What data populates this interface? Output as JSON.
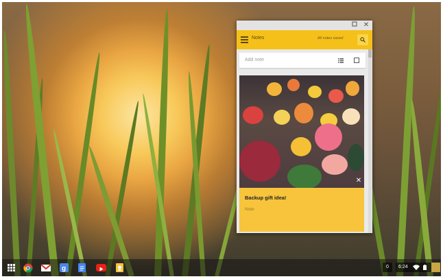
{
  "notes_window": {
    "app_title": "Notes",
    "save_status": "All notes saved",
    "add_note_placeholder": "Add note",
    "note": {
      "title": "Backup gift idea!",
      "placeholder": "Note"
    }
  },
  "shelf": {
    "apps": [
      "apps-launcher",
      "chrome",
      "gmail",
      "google-search",
      "docs",
      "youtube",
      "keep"
    ],
    "notification_count": "0",
    "clock": "6:24"
  },
  "colors": {
    "header": "#f6c01a",
    "card": "#f7c43c"
  }
}
